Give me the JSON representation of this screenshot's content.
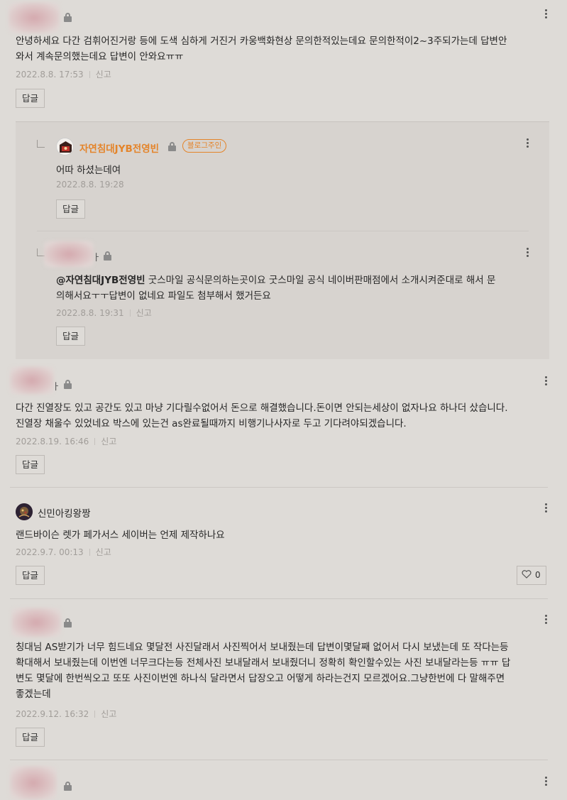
{
  "comments": [
    {
      "author_suffix": "",
      "text": "안녕하세요 다간 검휘어진거랑 등에 도색 심하게 거진거 카웅백화현상 문의한적있는데요 문의한적이2~3주되가는데 답변안와서 계속문의했는데요 답변이 안와요ㅠㅠ",
      "text_line1": "안녕하세요 다간 검휘어진거랑 등에 도색 심하게 거진거 카웅백화현상 문의한적있는데요 문의한적이2~3주되가는데 답변안",
      "text_line2": "와서 계속문의했는데요 답변이 안와요ㅠㅠ",
      "date": "2022.8.8. 17:53",
      "report": "신고",
      "reply_label": "답글"
    },
    {
      "author": "자연침대JYB전영빈",
      "badge": "블로그주인",
      "text": "어따 하셨는데여",
      "date": "2022.8.8. 19:28",
      "reply_label": "답글"
    },
    {
      "author_suffix": "ㅏ",
      "mention": "@자연침대JYB전영빈",
      "text_line1": " 굿스마일 공식문의하는곳이요 굿스마일 공식 네이버판매점에서 소개시켜준대로 해서 문",
      "text_line2": "의해서요ㅜㅜ답변이 없네요 파일도 첨부해서 했거든요",
      "date": "2022.8.8. 19:31",
      "report": "신고",
      "reply_label": "답글"
    },
    {
      "author_suffix": "ㅏ",
      "text_line1": "다간 진열장도 있고 공간도 있고 마냥 기다릴수없어서 돈으로 해결했습니다.돈이면 안되는세상이 없자나요 하나더 샀습니다.",
      "text_line2": "진열장 채울수 있었네요 박스에 있는건 as완료될때까지 비행기나사자로 두고 기다려야되겠습니다.",
      "date": "2022.8.19. 16:46",
      "report": "신고",
      "reply_label": "답글"
    },
    {
      "author": "신민아킹왕짱",
      "text": "랜드바이슨 렛가 페가서스 세이버는 언제 제작하나요",
      "date": "2022.9.7. 00:13",
      "report": "신고",
      "reply_label": "답글",
      "like_count": "0"
    },
    {
      "author_suffix": "",
      "text_line1": "칭대님 AS받기가 너무 힘드네요 몇달전 사진달래서 사진찍어서 보내줬는데 답변이몇달째 없어서 다시 보냈는데 또 작다는등",
      "text_line2": "확대해서 보내줬는데 이번엔 너무크다는등 전체사진 보내달래서 보내줬더니 정확히 확인할수있는 사진 보내달라는등 ㅠㅠ 답",
      "text_line3": "변도 몇달에 한번씩오고 또또 사진이번엔 하나식 달라면서 답장오고 어떻게 하라는건지 모르겠어요.그냥한번에 다 말해주면",
      "text_line4": "좋겠는데",
      "date": "2022.9.12. 16:32",
      "report": "신고",
      "reply_label": "답글"
    }
  ],
  "icons": {
    "lock": "lock-icon",
    "more": "more-vertical-icon",
    "heart": "heart-icon"
  }
}
